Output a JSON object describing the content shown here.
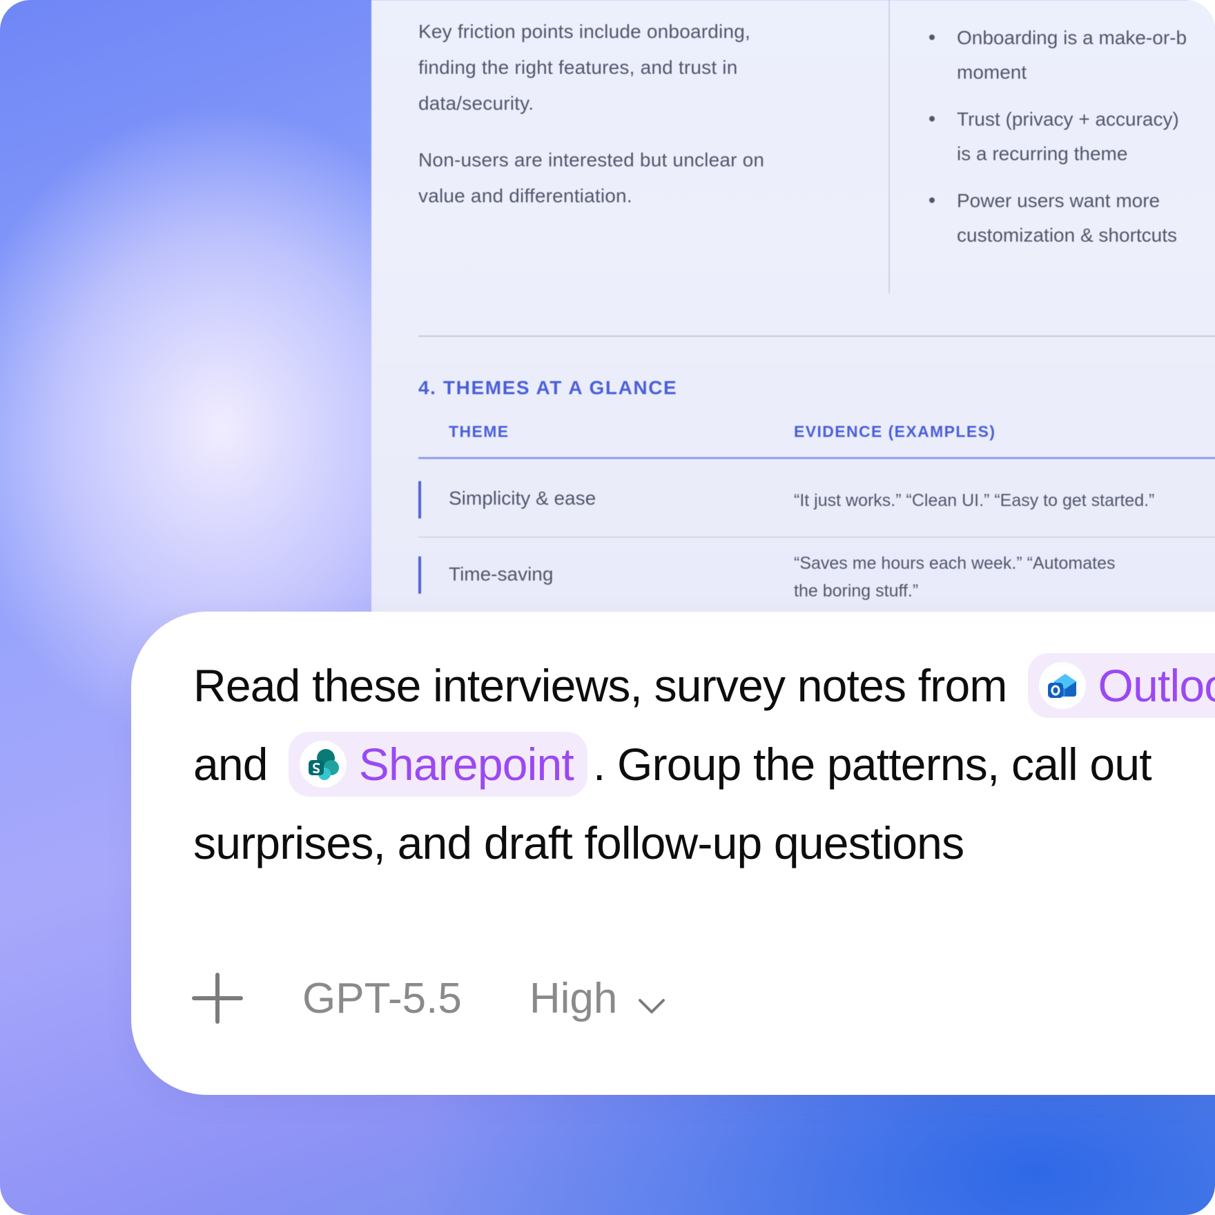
{
  "document": {
    "left_paragraphs": [
      [
        "Key friction points include onboarding,",
        "finding the right features, and trust in",
        "data/security."
      ],
      [
        "Non-users are interested but unclear on",
        "value and differentiation."
      ]
    ],
    "bullets": [
      [
        "Onboarding is a make-or-b",
        "moment"
      ],
      [
        "Trust (privacy + accuracy)",
        "is a recurring theme"
      ],
      [
        "Power users want more",
        "customization & shortcuts"
      ]
    ],
    "section_title": "4. THEMES AT A GLANCE",
    "table": {
      "headers": [
        "THEME",
        "EVIDENCE (EXAMPLES)"
      ],
      "rows": [
        {
          "theme": "Simplicity & ease",
          "evidence": [
            "“It just works.” “Clean UI.” “Easy to get started.”"
          ]
        },
        {
          "theme": "Time-saving",
          "evidence": [
            "“Saves me hours each week.” “Automates",
            "the boring stuff.”"
          ]
        }
      ]
    }
  },
  "composer": {
    "prompt": {
      "line1_text": "Read these interviews, survey notes from",
      "chip1_label": "Outlook",
      "line2_start": "and",
      "chip2_label": "Sharepoint",
      "line2_end": ". Group the patterns, call out",
      "line3_text": "surprises, and draft follow-up questions"
    },
    "icons": {
      "chip1": "outlook-icon",
      "chip2": "sharepoint-icon",
      "add": "plus-icon",
      "effort_dropdown": "chevron-down-icon"
    },
    "model_label": "GPT-5.5",
    "effort_label": "High"
  },
  "colors": {
    "chip_text": "#9b49f2",
    "chip_bg": "#f3ebfb",
    "doc_accent": "#4a5fd8"
  }
}
